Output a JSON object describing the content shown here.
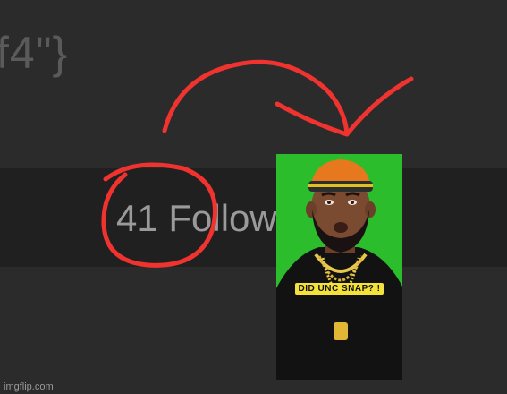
{
  "top_snippet": "f4\"}",
  "followers_text": "41 Follow",
  "video": {
    "caption": "DID UNC SNAP? !"
  },
  "watermark": "imgflip.com",
  "colors": {
    "annotation": "#f0332f",
    "caption_bg": "#f4e23a",
    "green_screen": "#2bbf2b"
  }
}
